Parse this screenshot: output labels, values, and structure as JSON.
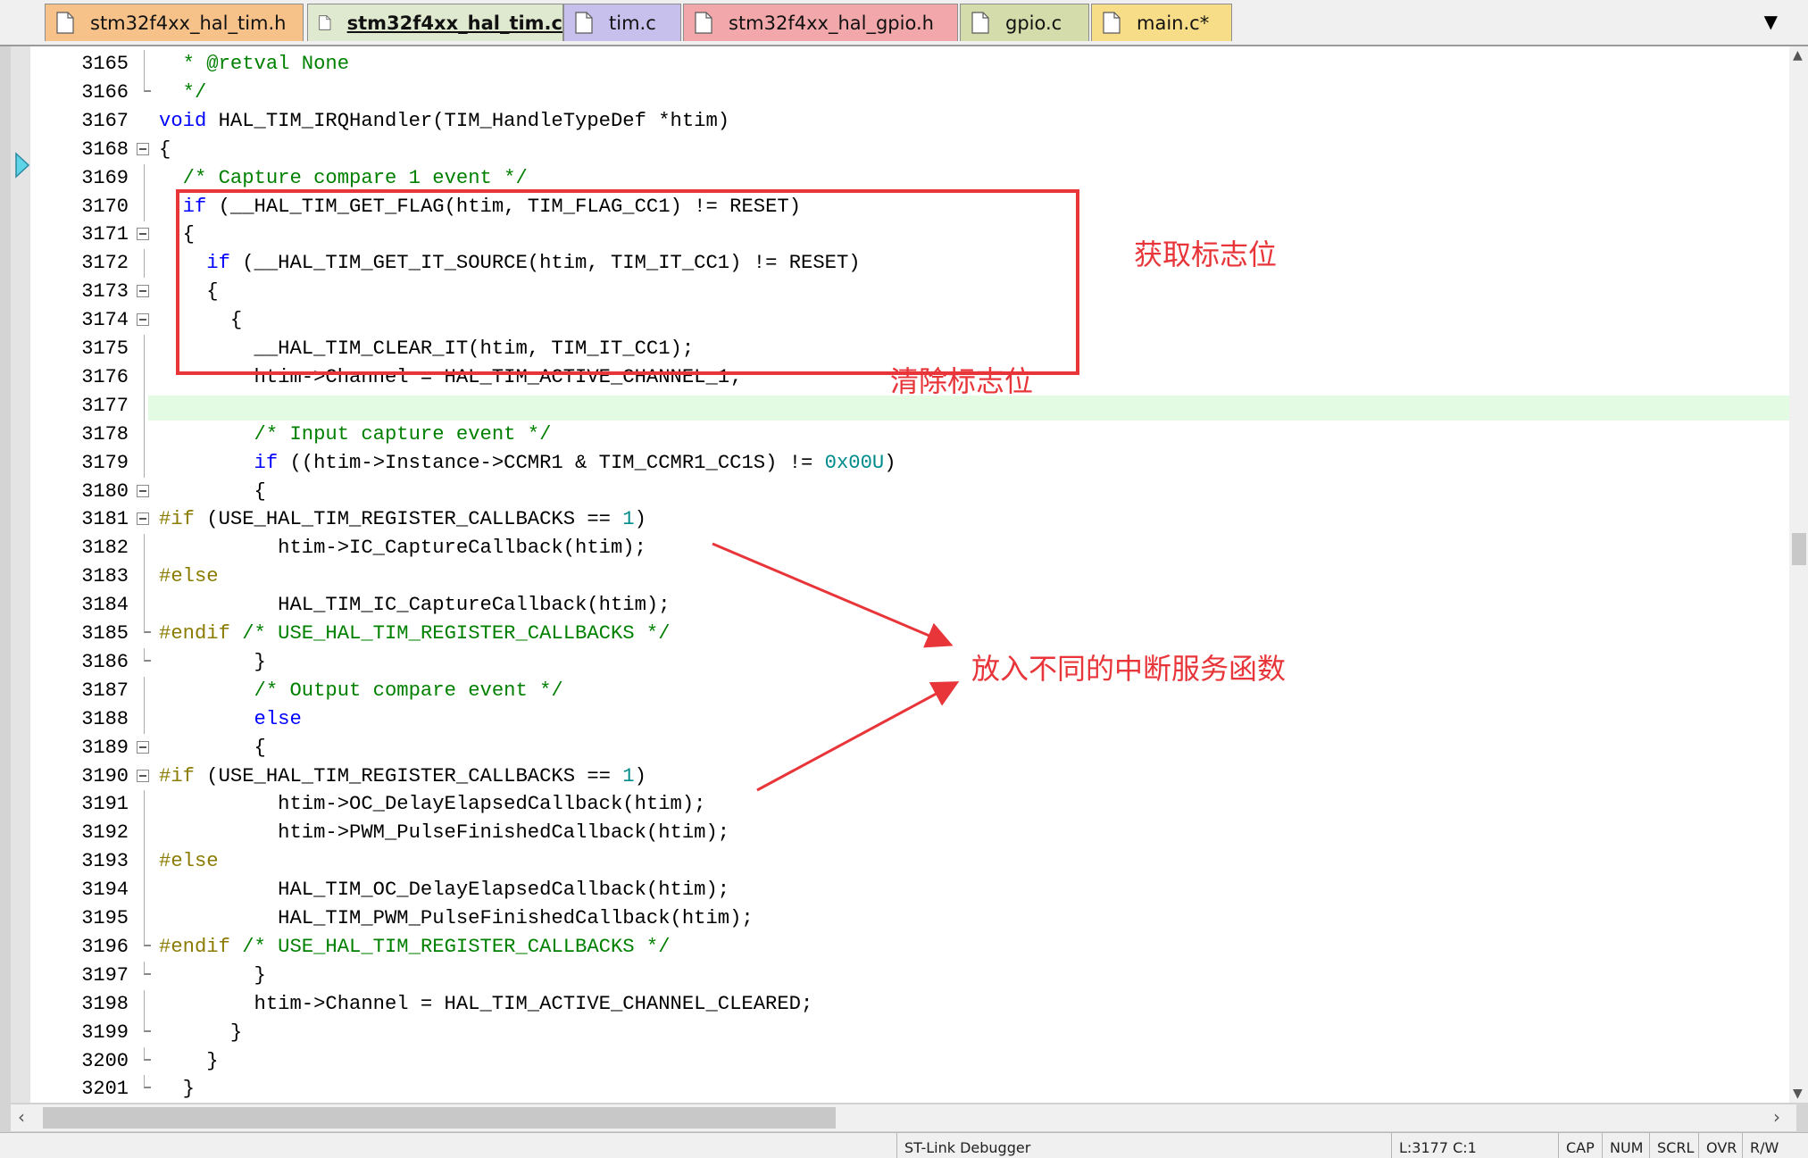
{
  "tabs": [
    {
      "label": "stm32f4xx_hal_tim.h",
      "color": "#f7c28a",
      "active": false
    },
    {
      "label": "stm32f4xx_hal_tim.c",
      "color": "#c9dcaa",
      "active": true
    },
    {
      "label": "tim.c",
      "color": "#c8c0ec",
      "active": false
    },
    {
      "label": "stm32f4xx_hal_gpio.h",
      "color": "#f2a8ab",
      "active": false
    },
    {
      "label": "gpio.c",
      "color": "#d3dcaa",
      "active": false
    },
    {
      "label": "main.c*",
      "color": "#f8dd88",
      "active": false
    }
  ],
  "tab_menu_icon": "chevron-down-icon",
  "editor": {
    "current_line": 3177,
    "lines": [
      {
        "n": "3165",
        "fold": "line",
        "segs": [
          [
            "  ",
            ""
          ],
          [
            "* @retval None",
            "cm"
          ]
        ]
      },
      {
        "n": "3166",
        "fold": "end",
        "segs": [
          [
            "  ",
            ""
          ],
          [
            "*/",
            "cm"
          ]
        ]
      },
      {
        "n": "3167",
        "fold": "",
        "segs": [
          [
            "void",
            "kw"
          ],
          [
            " HAL_TIM_IRQHandler(TIM_HandleTypeDef *htim)",
            ""
          ]
        ]
      },
      {
        "n": "3168",
        "fold": "box",
        "segs": [
          [
            "{",
            ""
          ]
        ]
      },
      {
        "n": "3169",
        "fold": "line",
        "segs": [
          [
            "  ",
            ""
          ],
          [
            "/* Capture compare 1 event */",
            "cm"
          ]
        ]
      },
      {
        "n": "3170",
        "fold": "line",
        "segs": [
          [
            "  ",
            ""
          ],
          [
            "if",
            "kw"
          ],
          [
            " (__HAL_TIM_GET_FLAG(htim, TIM_FLAG_CC1) != RESET)",
            ""
          ]
        ]
      },
      {
        "n": "3171",
        "fold": "box",
        "segs": [
          [
            "  {",
            ""
          ]
        ]
      },
      {
        "n": "3172",
        "fold": "line",
        "segs": [
          [
            "    ",
            ""
          ],
          [
            "if",
            "kw"
          ],
          [
            " (__HAL_TIM_GET_IT_SOURCE(htim, TIM_IT_CC1) != RESET)",
            ""
          ]
        ]
      },
      {
        "n": "3173",
        "fold": "box",
        "segs": [
          [
            "    {",
            ""
          ]
        ]
      },
      {
        "n": "3174",
        "fold": "box",
        "segs": [
          [
            "      {",
            ""
          ]
        ]
      },
      {
        "n": "3175",
        "fold": "line",
        "segs": [
          [
            "        __HAL_TIM_CLEAR_IT(htim, TIM_IT_CC1);",
            ""
          ]
        ]
      },
      {
        "n": "3176",
        "fold": "line",
        "segs": [
          [
            "        htim->Channel = HAL_TIM_ACTIVE_CHANNEL_1;",
            ""
          ]
        ]
      },
      {
        "n": "3177",
        "fold": "line",
        "segs": [
          [
            "",
            ""
          ]
        ]
      },
      {
        "n": "3178",
        "fold": "line",
        "segs": [
          [
            "        ",
            ""
          ],
          [
            "/* Input capture event */",
            "cm"
          ]
        ]
      },
      {
        "n": "3179",
        "fold": "line",
        "segs": [
          [
            "        ",
            ""
          ],
          [
            "if",
            "kw"
          ],
          [
            " ((htim->Instance->CCMR1 & TIM_CCMR1_CC1S) != ",
            ""
          ],
          [
            "0x00U",
            "nm"
          ],
          [
            ")",
            ""
          ]
        ]
      },
      {
        "n": "3180",
        "fold": "box",
        "segs": [
          [
            "        {",
            ""
          ]
        ]
      },
      {
        "n": "3181",
        "fold": "box",
        "segs": [
          [
            "#if",
            "pp"
          ],
          [
            " (USE_HAL_TIM_REGISTER_CALLBACKS == ",
            ""
          ],
          [
            "1",
            "nm"
          ],
          [
            ")",
            ""
          ]
        ]
      },
      {
        "n": "3182",
        "fold": "line",
        "segs": [
          [
            "          htim->IC_CaptureCallback(htim);",
            ""
          ]
        ]
      },
      {
        "n": "3183",
        "fold": "line",
        "segs": [
          [
            "#else",
            "pp"
          ]
        ]
      },
      {
        "n": "3184",
        "fold": "line",
        "segs": [
          [
            "          HAL_TIM_IC_CaptureCallback(htim);",
            ""
          ]
        ]
      },
      {
        "n": "3185",
        "fold": "end",
        "segs": [
          [
            "#endif",
            "pp"
          ],
          [
            " ",
            ""
          ],
          [
            "/* USE_HAL_TIM_REGISTER_CALLBACKS */",
            "cm"
          ]
        ]
      },
      {
        "n": "3186",
        "fold": "end",
        "segs": [
          [
            "        }",
            ""
          ]
        ]
      },
      {
        "n": "3187",
        "fold": "line",
        "segs": [
          [
            "        ",
            ""
          ],
          [
            "/* Output compare event */",
            "cm"
          ]
        ]
      },
      {
        "n": "3188",
        "fold": "line",
        "segs": [
          [
            "        ",
            ""
          ],
          [
            "else",
            "kw"
          ]
        ]
      },
      {
        "n": "3189",
        "fold": "box",
        "segs": [
          [
            "        {",
            ""
          ]
        ]
      },
      {
        "n": "3190",
        "fold": "box",
        "segs": [
          [
            "#if",
            "pp"
          ],
          [
            " (USE_HAL_TIM_REGISTER_CALLBACKS == ",
            ""
          ],
          [
            "1",
            "nm"
          ],
          [
            ")",
            ""
          ]
        ]
      },
      {
        "n": "3191",
        "fold": "line",
        "segs": [
          [
            "          htim->OC_DelayElapsedCallback(htim);",
            ""
          ]
        ]
      },
      {
        "n": "3192",
        "fold": "line",
        "segs": [
          [
            "          htim->PWM_PulseFinishedCallback(htim);",
            ""
          ]
        ]
      },
      {
        "n": "3193",
        "fold": "line",
        "segs": [
          [
            "#else",
            "pp"
          ]
        ]
      },
      {
        "n": "3194",
        "fold": "line",
        "segs": [
          [
            "          HAL_TIM_OC_DelayElapsedCallback(htim);",
            ""
          ]
        ]
      },
      {
        "n": "3195",
        "fold": "line",
        "segs": [
          [
            "          HAL_TIM_PWM_PulseFinishedCallback(htim);",
            ""
          ]
        ]
      },
      {
        "n": "3196",
        "fold": "end",
        "segs": [
          [
            "#endif",
            "pp"
          ],
          [
            " ",
            ""
          ],
          [
            "/* USE_HAL_TIM_REGISTER_CALLBACKS */",
            "cm"
          ]
        ]
      },
      {
        "n": "3197",
        "fold": "end",
        "segs": [
          [
            "        }",
            ""
          ]
        ]
      },
      {
        "n": "3198",
        "fold": "line",
        "segs": [
          [
            "        htim->Channel = HAL_TIM_ACTIVE_CHANNEL_CLEARED;",
            ""
          ]
        ]
      },
      {
        "n": "3199",
        "fold": "end",
        "segs": [
          [
            "      }",
            ""
          ]
        ]
      },
      {
        "n": "3200",
        "fold": "end",
        "segs": [
          [
            "    }",
            ""
          ]
        ]
      },
      {
        "n": "3201",
        "fold": "end",
        "segs": [
          [
            "  }",
            ""
          ]
        ]
      }
    ]
  },
  "annotations": {
    "get_flag": "获取标志位",
    "clear_flag": "清除标志位",
    "callbacks": "放入不同的中断服务函数",
    "color": "#e8353a"
  },
  "statusbar": {
    "debugger": "ST-Link Debugger",
    "position": "L:3177 C:1",
    "caps": "CAP",
    "num": "NUM",
    "scrl": "SCRL",
    "ovr": "OVR",
    "rw": "R/W"
  }
}
